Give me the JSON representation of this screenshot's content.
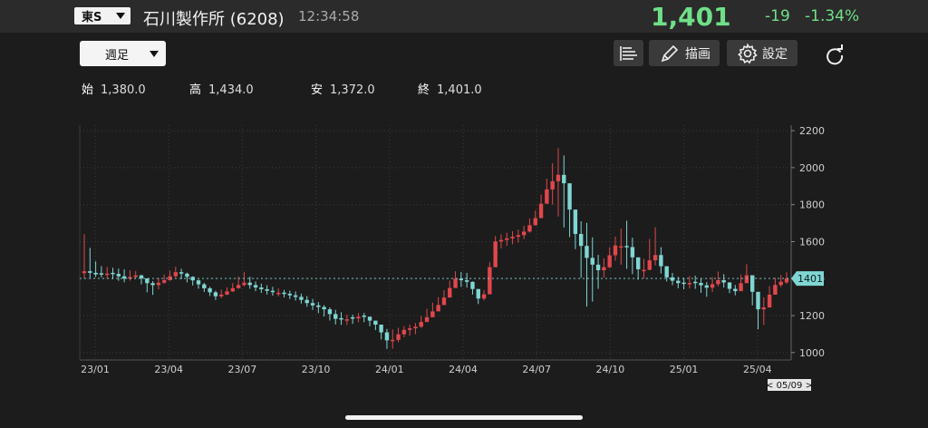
{
  "header": {
    "market": "東S",
    "name": "石川製作所 (6208)",
    "time": "12:34:58",
    "price": "1,401",
    "change": "-19",
    "change_pct": "-1.34%"
  },
  "toolbar": {
    "period": "週足",
    "draw_label": "描画",
    "settings_label": "設定"
  },
  "ohlc": {
    "open_label": "始",
    "open": "1,380.0",
    "high_label": "高",
    "high": "1,434.0",
    "low_label": "安",
    "low": "1,372.0",
    "close_label": "終",
    "close": "1,401.0"
  },
  "colors": {
    "up": "#e0474c",
    "down": "#7fd6d3",
    "positive": "#6fe089"
  },
  "chart_data": {
    "type": "candlestick",
    "y_ticks": [
      1000,
      1200,
      1400,
      1600,
      1800,
      2000,
      2200
    ],
    "ylim": [
      960,
      2230
    ],
    "x_tick_labels": [
      "23/01",
      "23/04",
      "23/07",
      "23/10",
      "24/01",
      "24/04",
      "24/07",
      "24/10",
      "25/01",
      "25/04"
    ],
    "last_price_label": "1401",
    "last_price": 1401,
    "date_cursor_label": "< 05/09 >",
    "grid": true,
    "anchors": [
      [
        1440,
        1640,
        1400
      ],
      [
        1420,
        1470,
        1410
      ],
      [
        1430,
        1460,
        1400
      ],
      [
        1400,
        1450,
        1380
      ],
      [
        1420,
        1440,
        1400
      ],
      [
        1360,
        1380,
        1300
      ],
      [
        1390,
        1420,
        1370
      ],
      [
        1440,
        1470,
        1410
      ],
      [
        1400,
        1420,
        1370
      ],
      [
        1350,
        1380,
        1330
      ],
      [
        1300,
        1330,
        1280
      ],
      [
        1340,
        1360,
        1320
      ],
      [
        1380,
        1440,
        1360
      ],
      [
        1350,
        1380,
        1330
      ],
      [
        1330,
        1360,
        1310
      ],
      [
        1320,
        1340,
        1300
      ],
      [
        1300,
        1330,
        1280
      ],
      [
        1260,
        1300,
        1240
      ],
      [
        1240,
        1260,
        1200
      ],
      [
        1180,
        1230,
        1150
      ],
      [
        1180,
        1200,
        1150
      ],
      [
        1200,
        1220,
        1170
      ],
      [
        1150,
        1170,
        1120
      ],
      [
        1050,
        1120,
        1000
      ],
      [
        1120,
        1140,
        1080
      ],
      [
        1140,
        1160,
        1100
      ],
      [
        1200,
        1250,
        1180
      ],
      [
        1280,
        1320,
        1250
      ],
      [
        1400,
        1440,
        1360
      ],
      [
        1380,
        1430,
        1350
      ],
      [
        1260,
        1280,
        1230
      ],
      [
        1600,
        1630,
        1550
      ],
      [
        1620,
        1650,
        1580
      ],
      [
        1640,
        1670,
        1600
      ],
      [
        1720,
        1760,
        1680
      ],
      [
        1900,
        1960,
        1850
      ],
      [
        1980,
        2150,
        1700
      ],
      [
        1650,
        1720,
        1580
      ],
      [
        1500,
        1700,
        1220
      ],
      [
        1430,
        1480,
        1380
      ],
      [
        1580,
        1620,
        1500
      ],
      [
        1570,
        1720,
        1450
      ],
      [
        1420,
        1450,
        1380
      ],
      [
        1540,
        1700,
        1480
      ],
      [
        1400,
        1450,
        1380
      ],
      [
        1370,
        1400,
        1340
      ],
      [
        1380,
        1420,
        1350
      ],
      [
        1350,
        1380,
        1300
      ],
      [
        1400,
        1450,
        1370
      ],
      [
        1320,
        1350,
        1300
      ],
      [
        1420,
        1480,
        1380
      ],
      [
        1200,
        1260,
        1080
      ],
      [
        1360,
        1400,
        1330
      ],
      [
        1401,
        1434,
        1372
      ]
    ],
    "n_weeks": 124
  }
}
